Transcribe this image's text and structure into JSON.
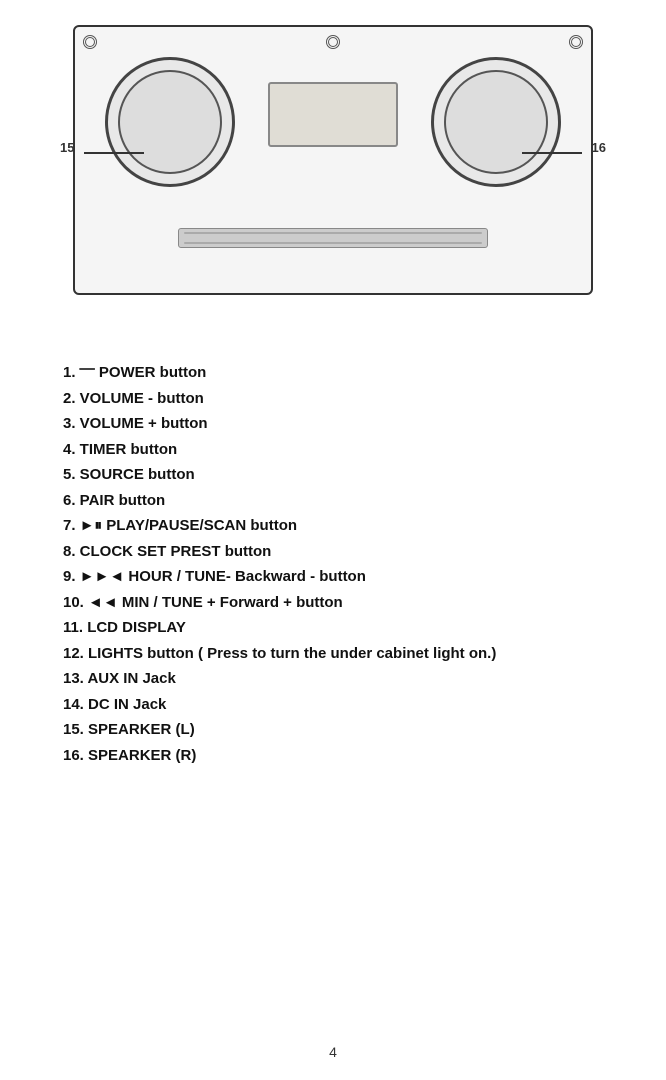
{
  "device": {
    "label_left": "15",
    "label_right": "16"
  },
  "parts": [
    {
      "id": "item-1",
      "text": "1. ⎻ POWER button"
    },
    {
      "id": "item-2",
      "text": "2. VOLUME - button"
    },
    {
      "id": "item-3",
      "text": "3. VOLUME + button"
    },
    {
      "id": "item-4",
      "text": "4. TIMER button"
    },
    {
      "id": "item-5",
      "text": "5. SOURCE button"
    },
    {
      "id": "item-6",
      "text": "6. PAIR button"
    },
    {
      "id": "item-7",
      "text": "7. ►⏸  PLAY/PAUSE/SCAN button"
    },
    {
      "id": "item-8",
      "text": "8. CLOCK SET PREST button"
    },
    {
      "id": "item-9",
      "text": "9.  ►►◄  HOUR / TUNE- Backward - button"
    },
    {
      "id": "item-10",
      "text": "10. ◄◄  MIN  / TUNE + Forward + button"
    },
    {
      "id": "item-11",
      "text": "11. LCD DISPLAY"
    },
    {
      "id": "item-12",
      "text": "12. LIGHTS button ( Press to turn the under cabinet light on.)"
    },
    {
      "id": "item-13",
      "text": "13. AUX IN Jack"
    },
    {
      "id": "item-14",
      "text": "14. DC IN Jack"
    },
    {
      "id": "item-15",
      "text": "15. SPEARKER (L)"
    },
    {
      "id": "item-16",
      "text": "16. SPEARKER (R)"
    }
  ],
  "page_number": "4"
}
